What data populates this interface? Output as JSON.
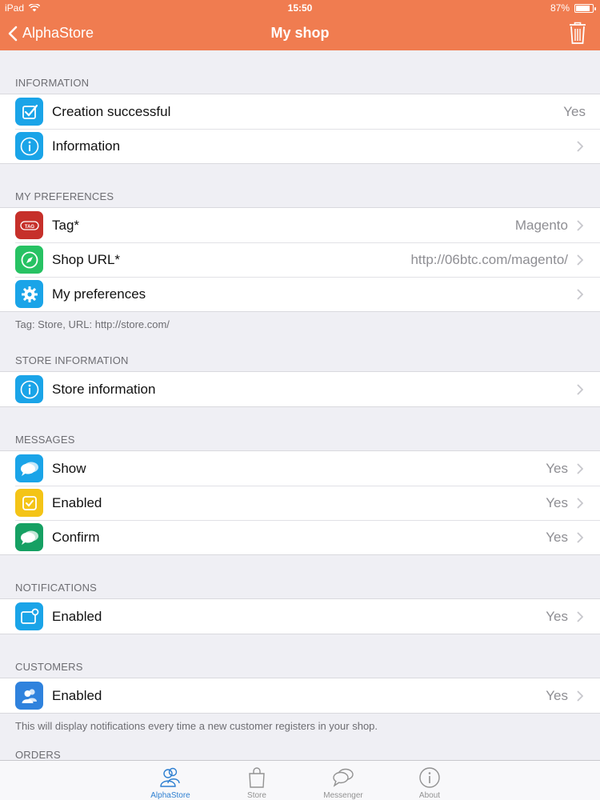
{
  "status": {
    "device": "iPad",
    "time": "15:50",
    "battery": "87%",
    "battery_level": 0.87
  },
  "nav": {
    "back_label": "AlphaStore",
    "title": "My shop"
  },
  "sections": {
    "information": {
      "header": "INFORMATION",
      "rows": [
        {
          "label": "Creation successful",
          "value": "Yes"
        },
        {
          "label": "Information",
          "value": ""
        }
      ]
    },
    "preferences": {
      "header": "MY PREFERENCES",
      "rows": [
        {
          "label": "Tag*",
          "value": "Magento",
          "icon_text": "TAG"
        },
        {
          "label": "Shop URL*",
          "value": "http://06btc.com/magento/"
        },
        {
          "label": "My preferences",
          "value": ""
        }
      ],
      "footer": "Tag: Store, URL: http://store.com/"
    },
    "store_info": {
      "header": "STORE INFORMATION",
      "rows": [
        {
          "label": "Store information",
          "value": ""
        }
      ]
    },
    "messages": {
      "header": "MESSAGES",
      "rows": [
        {
          "label": "Show",
          "value": "Yes"
        },
        {
          "label": "Enabled",
          "value": "Yes"
        },
        {
          "label": "Confirm",
          "value": "Yes"
        }
      ]
    },
    "notifications": {
      "header": "NOTIFICATIONS",
      "rows": [
        {
          "label": "Enabled",
          "value": "Yes"
        }
      ]
    },
    "customers": {
      "header": "CUSTOMERS",
      "rows": [
        {
          "label": "Enabled",
          "value": "Yes"
        }
      ],
      "footer": "This will display notifications every time a new customer registers in your shop."
    },
    "orders": {
      "header": "ORDERS"
    }
  },
  "tabs": [
    {
      "label": "AlphaStore",
      "icon": "people-icon",
      "active": true
    },
    {
      "label": "Store",
      "icon": "bag-icon",
      "active": false
    },
    {
      "label": "Messenger",
      "icon": "chat-bubbles-icon",
      "active": false
    },
    {
      "label": "About",
      "icon": "info-icon",
      "active": false
    }
  ],
  "colors": {
    "nav_bar": "#f07c50",
    "icon_blue": "#1aa4e8",
    "icon_red": "#c6302a",
    "icon_green": "#27c263",
    "icon_yellow": "#f4c417",
    "icon_teal": "#16a063",
    "icon_dark_blue": "#2f82dd",
    "tab_active": "#2d7fd1"
  }
}
